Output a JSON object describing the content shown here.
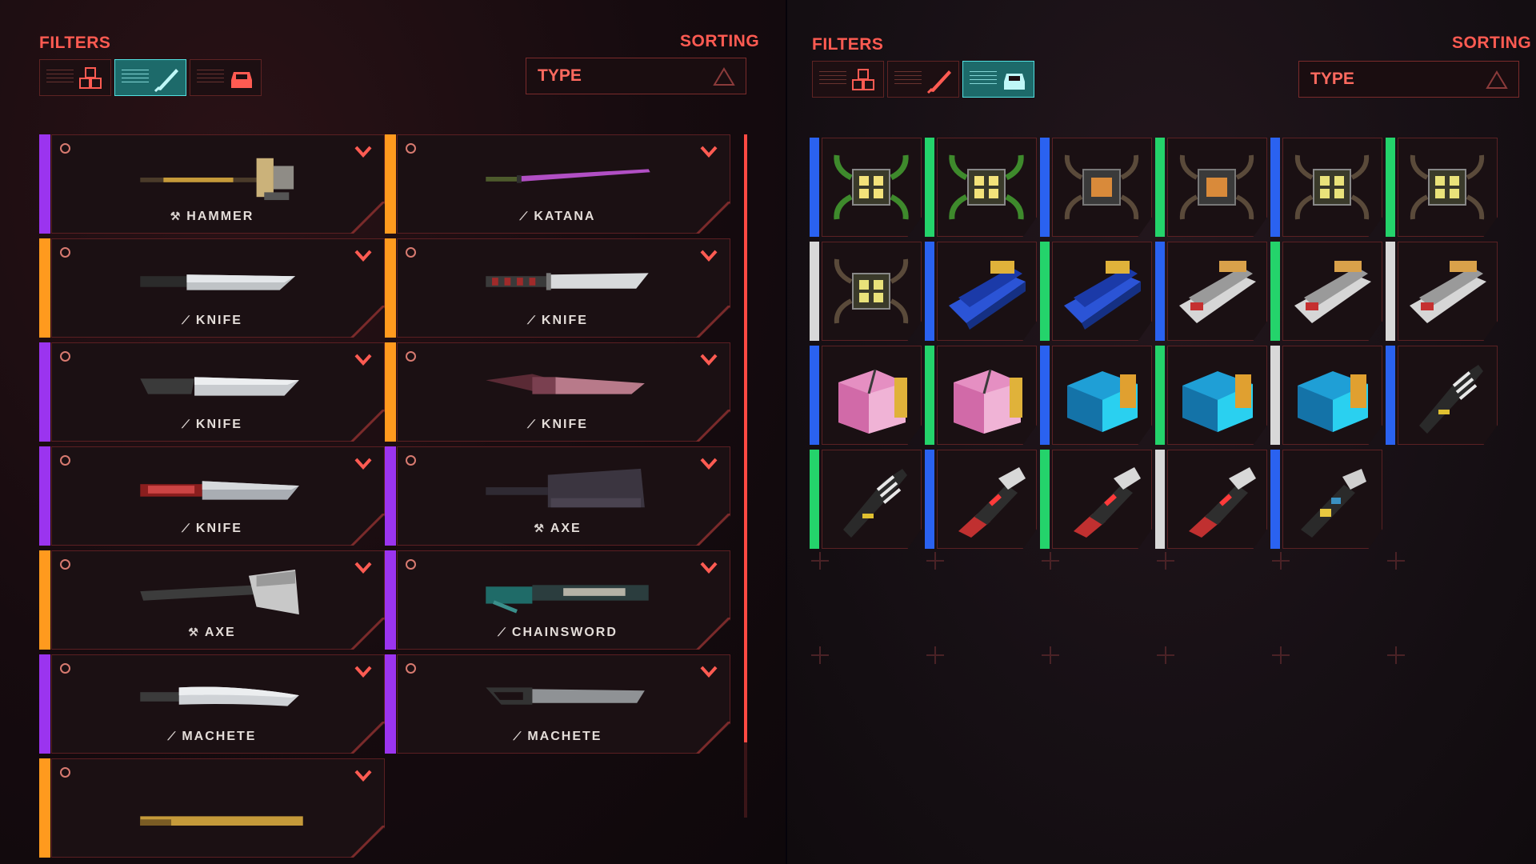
{
  "colors": {
    "accent_red": "#ff5b52",
    "cyan_active": "#52e1e1",
    "rarity_purple": "#9b34ef",
    "rarity_orange": "#ff9a1e",
    "rarity_blue": "#2a62f0",
    "rarity_green": "#24d36b",
    "rarity_white": "#d8d8d8"
  },
  "left": {
    "filters_label": "FILTERS",
    "sorting_label": "SORTING",
    "sort_value": "TYPE",
    "filter_buttons": [
      {
        "icon": "cube-stack-icon",
        "active": false
      },
      {
        "icon": "blade-icon",
        "active": true
      },
      {
        "icon": "vehicle-icon",
        "active": false
      }
    ],
    "weapons": [
      {
        "label": "HAMMER",
        "type_icon": "blunt-icon",
        "rarity": "purple",
        "art": "hammer"
      },
      {
        "label": "KATANA",
        "type_icon": "blade-icon",
        "rarity": "orange",
        "art": "katana"
      },
      {
        "label": "KNIFE",
        "type_icon": "blade-icon",
        "rarity": "orange",
        "art": "knife1"
      },
      {
        "label": "KNIFE",
        "type_icon": "blade-icon",
        "rarity": "orange",
        "art": "knife2"
      },
      {
        "label": "KNIFE",
        "type_icon": "blade-icon",
        "rarity": "purple",
        "art": "knife3"
      },
      {
        "label": "KNIFE",
        "type_icon": "blade-icon",
        "rarity": "orange",
        "art": "knife4"
      },
      {
        "label": "KNIFE",
        "type_icon": "blade-icon",
        "rarity": "purple",
        "art": "knife5"
      },
      {
        "label": "AXE",
        "type_icon": "blunt-icon",
        "rarity": "purple",
        "art": "cleaver"
      },
      {
        "label": "AXE",
        "type_icon": "blunt-icon",
        "rarity": "orange",
        "art": "axe"
      },
      {
        "label": "CHAINSWORD",
        "type_icon": "blade-icon",
        "rarity": "purple",
        "art": "chainsword"
      },
      {
        "label": "MACHETE",
        "type_icon": "blade-icon",
        "rarity": "purple",
        "art": "machete1"
      },
      {
        "label": "MACHETE",
        "type_icon": "blade-icon",
        "rarity": "purple",
        "art": "machete2"
      },
      {
        "label": "",
        "type_icon": "",
        "rarity": "orange",
        "art": "partial"
      }
    ]
  },
  "right": {
    "filters_label": "FILTERS",
    "sorting_label": "SORTING",
    "sort_value": "TYPE",
    "filter_buttons": [
      {
        "icon": "cube-stack-icon",
        "active": false
      },
      {
        "icon": "blade-icon",
        "active": false
      },
      {
        "icon": "vehicle-icon",
        "active": true
      }
    ],
    "items": [
      {
        "kind": "chip-green",
        "rarity": "blue"
      },
      {
        "kind": "chip-green",
        "rarity": "green"
      },
      {
        "kind": "chip-orange",
        "rarity": "blue"
      },
      {
        "kind": "chip-orange",
        "rarity": "green"
      },
      {
        "kind": "chip-dark",
        "rarity": "blue"
      },
      {
        "kind": "chip-dark",
        "rarity": "green"
      },
      {
        "kind": "chip-dark",
        "rarity": "white"
      },
      {
        "kind": "board-blue",
        "rarity": "blue"
      },
      {
        "kind": "board-blue",
        "rarity": "green"
      },
      {
        "kind": "board-white",
        "rarity": "blue"
      },
      {
        "kind": "board-white",
        "rarity": "green"
      },
      {
        "kind": "board-white",
        "rarity": "white"
      },
      {
        "kind": "box-pink",
        "rarity": "blue"
      },
      {
        "kind": "box-pink",
        "rarity": "green"
      },
      {
        "kind": "box-cyan",
        "rarity": "blue"
      },
      {
        "kind": "box-cyan",
        "rarity": "green"
      },
      {
        "kind": "box-cyan",
        "rarity": "white"
      },
      {
        "kind": "gun-white",
        "rarity": "blue"
      },
      {
        "kind": "gun-white",
        "rarity": "green"
      },
      {
        "kind": "gun-red",
        "rarity": "blue"
      },
      {
        "kind": "gun-red",
        "rarity": "green"
      },
      {
        "kind": "gun-red",
        "rarity": "white"
      },
      {
        "kind": "gun-yellow",
        "rarity": "blue"
      }
    ]
  }
}
